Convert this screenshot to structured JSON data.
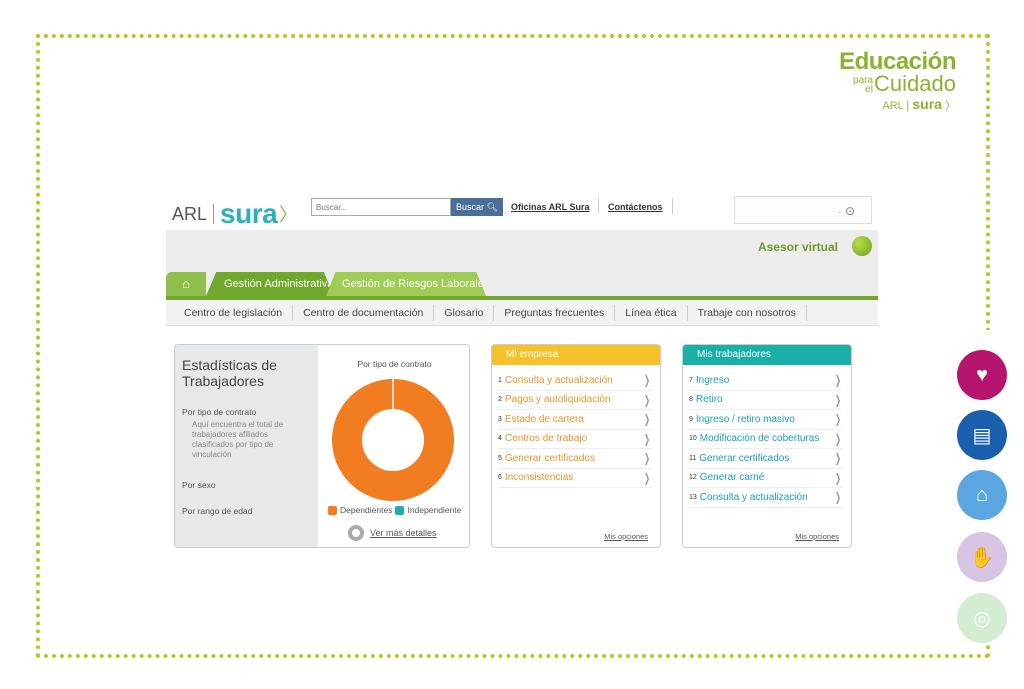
{
  "brand": {
    "line1": "Educación",
    "para": "para",
    "el": "el",
    "line2": "Cuidado",
    "arl": "ARL",
    "sura": "sura"
  },
  "topbar": {
    "logo_arl": "ARL",
    "logo_sura": "sura",
    "search_placeholder": "Buscar...",
    "search_button": "Buscar",
    "link_oficinas": "Oficinas ARL Sura",
    "link_contactenos": "Contáctenos"
  },
  "asesor": "Asesor virtual",
  "tabs": [
    {
      "label": "Gestión Administrativa"
    },
    {
      "label": "Gestión de Riesgos Laborales"
    }
  ],
  "subnav": [
    "Centro de legislación",
    "Centro de documentación",
    "Glosario",
    "Preguntas frecuentes",
    "Línea ética",
    "Trabaje con nosotros"
  ],
  "stats": {
    "title_1": "Estadísticas de",
    "title_2": "Trabajadores",
    "item_contract": "Por tipo de contrato",
    "item_contract_desc": "Aquí encuentra el total de trabajadores afiliados clasificados por tipo de vinculación",
    "item_sex": "Por sexo",
    "item_age": "Por rango de edad",
    "chart_title": "Por tipo de contrato",
    "legend_dep": "Dependientes",
    "legend_ind": "Independiente",
    "more": "Ver más detalles"
  },
  "chart_data": {
    "type": "pie",
    "title": "Por tipo de contrato",
    "categories": [
      "Dependientes",
      "Independiente"
    ],
    "values": [
      100,
      0
    ],
    "colors": [
      "#f27d20",
      "#1ab0a8"
    ]
  },
  "mi_empresa": {
    "title": "Mi empresa",
    "items": [
      {
        "n": "1",
        "label": "Consulta y actualización"
      },
      {
        "n": "2",
        "label": "Pagos y autoliquidación"
      },
      {
        "n": "3",
        "label": "Estado de cartera"
      },
      {
        "n": "4",
        "label": "Centros de trabajo"
      },
      {
        "n": "5",
        "label": "Generar certificados"
      },
      {
        "n": "6",
        "label": "Inconsistencias"
      }
    ],
    "options": "Mis opciones"
  },
  "mis_trabajadores": {
    "title": "Mis trabajadores",
    "items": [
      {
        "n": "7",
        "label": "Ingreso"
      },
      {
        "n": "8",
        "label": "Retiro"
      },
      {
        "n": "9",
        "label": "Ingreso / retiro masivo"
      },
      {
        "n": "10",
        "label": "Modificación de coberturas"
      },
      {
        "n": "11",
        "label": "Generar certificados"
      },
      {
        "n": "12",
        "label": "Generar carné"
      },
      {
        "n": "13",
        "label": "Consulta y actualización"
      }
    ],
    "options": "Mis opciones"
  },
  "colors": {
    "frame": "#b7c52a",
    "green": "#6fa82a",
    "orange_head": "#f5c22c",
    "teal_head": "#1ab0a8",
    "orange_text": "#e8952a",
    "teal_text": "#1c9fb5"
  },
  "side_icons": [
    "heart-icon",
    "notebook-icon",
    "factory-icon",
    "handshake-icon",
    "globe-plant-icon"
  ]
}
